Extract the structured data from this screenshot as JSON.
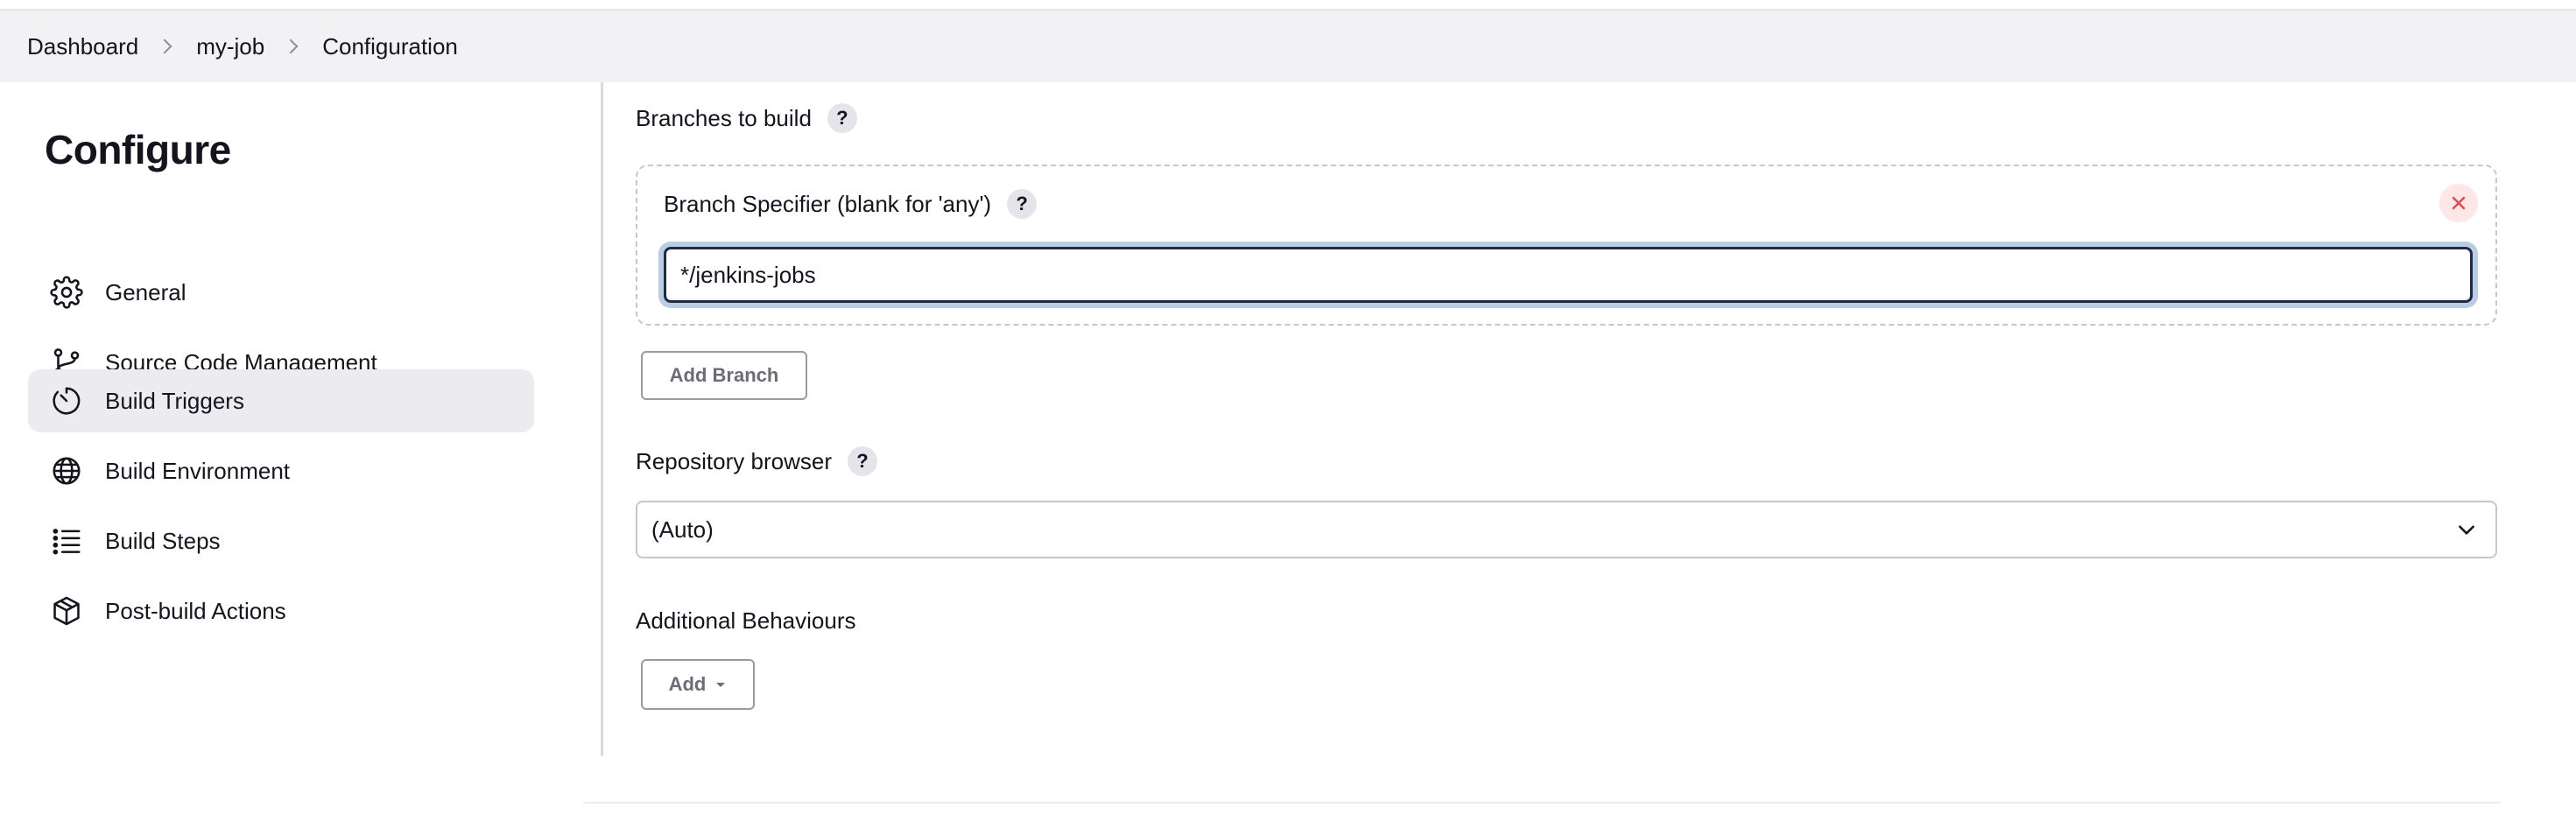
{
  "breadcrumb": {
    "items": [
      "Dashboard",
      "my-job",
      "Configuration"
    ]
  },
  "sidebar": {
    "title": "Configure",
    "items": [
      {
        "label": "General",
        "icon": "gear-icon",
        "active": false
      },
      {
        "label": "Source Code Management",
        "icon": "branch-icon",
        "active": false
      },
      {
        "label": "Build Triggers",
        "icon": "timer-icon",
        "active": true
      },
      {
        "label": "Build Environment",
        "icon": "globe-icon",
        "active": false
      },
      {
        "label": "Build Steps",
        "icon": "list-icon",
        "active": false
      },
      {
        "label": "Post-build Actions",
        "icon": "package-icon",
        "active": false
      }
    ]
  },
  "main": {
    "branches_to_build_label": "Branches to build",
    "branch_specifier_label": "Branch Specifier (blank for 'any')",
    "branch_specifier_value": "*/jenkins-jobs",
    "add_branch_label": "Add Branch",
    "repository_browser_label": "Repository browser",
    "repository_browser_value": "(Auto)",
    "additional_behaviours_label": "Additional Behaviours",
    "add_label": "Add",
    "help_glyph": "?"
  },
  "colors": {
    "delete_icon": "#e0484d",
    "focus_ring": "#b9cde4",
    "active_nav_bg": "#ebebf0"
  }
}
